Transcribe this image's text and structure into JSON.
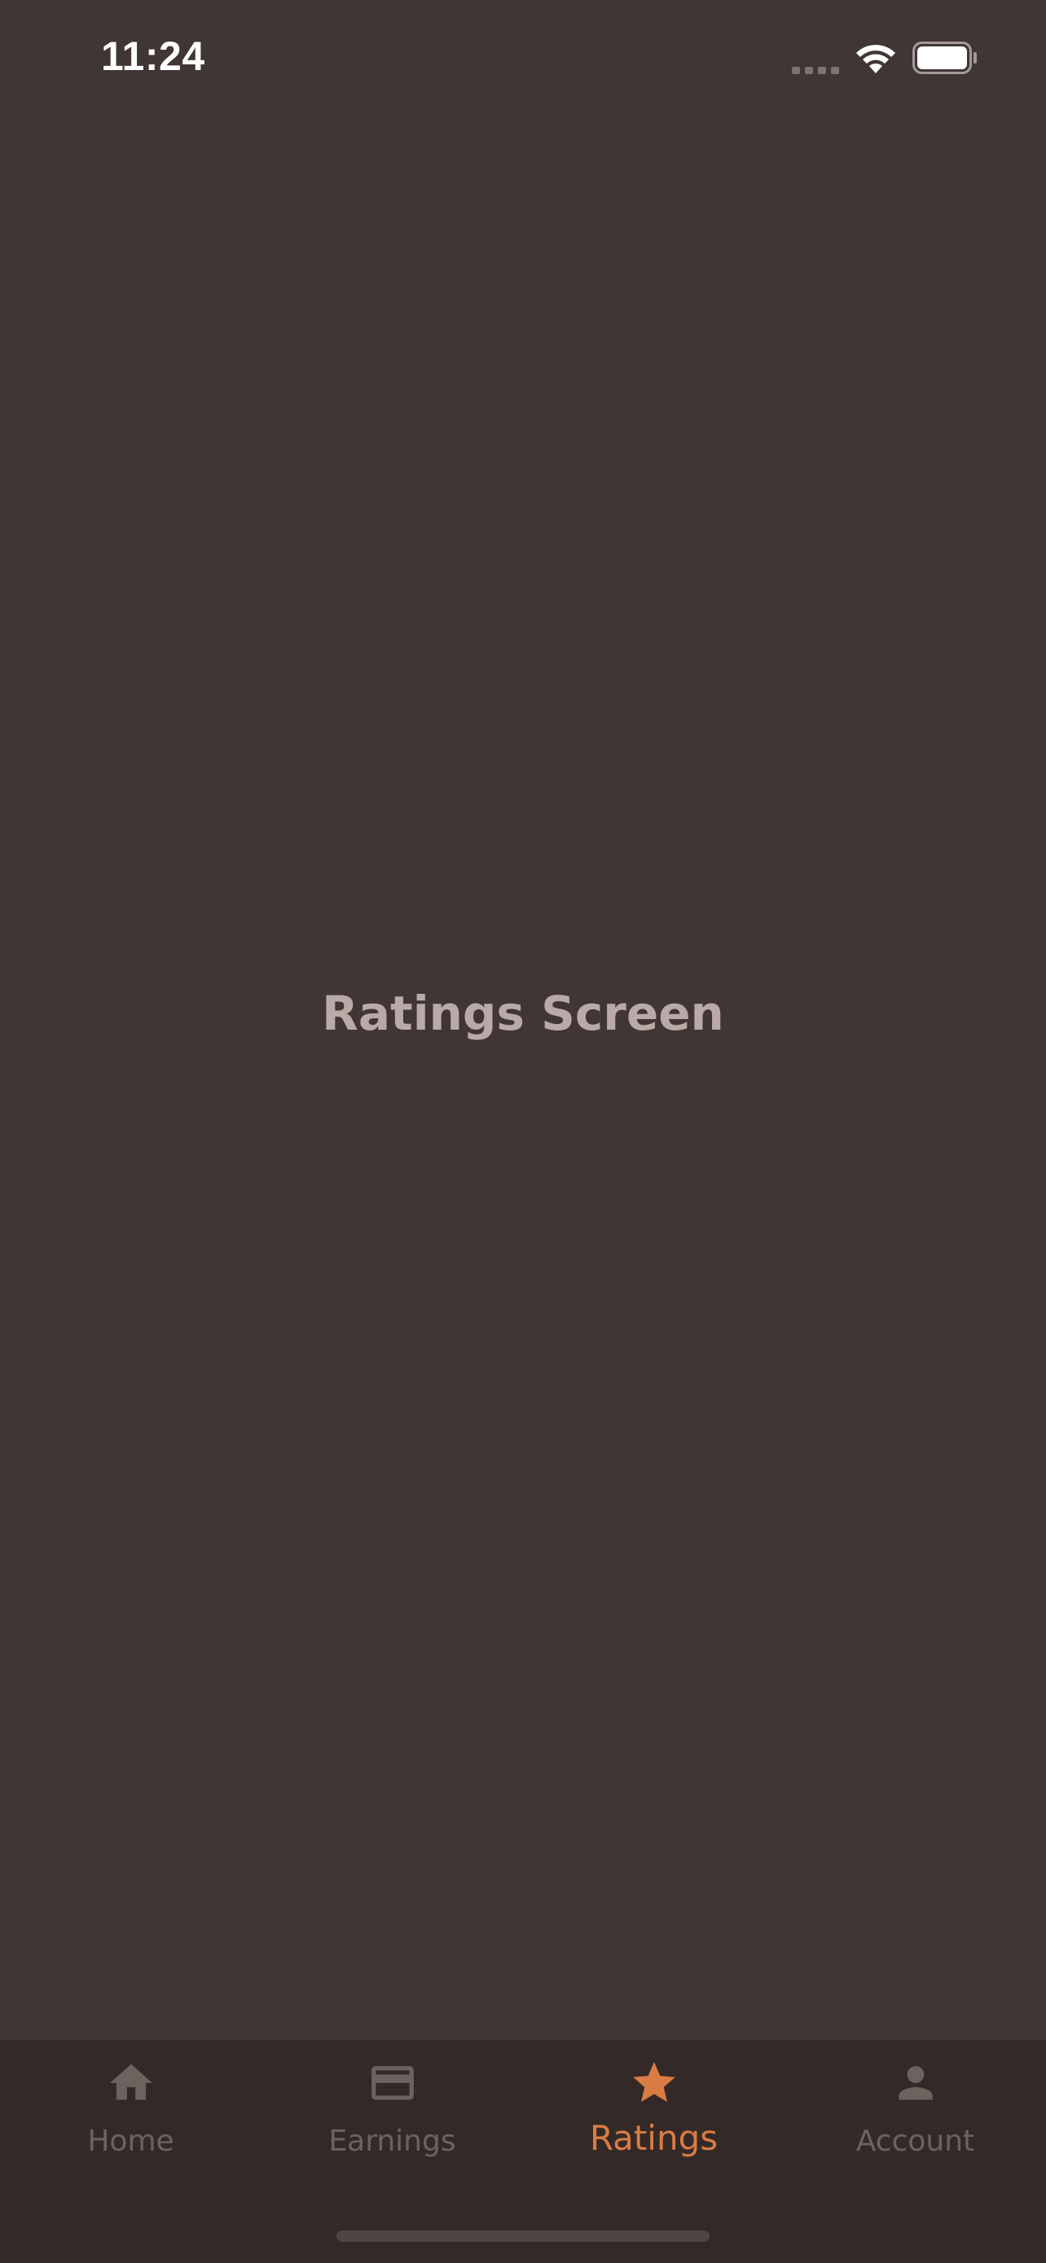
{
  "status_bar": {
    "time": "11:24",
    "signal_icon": "signal-dots-icon",
    "wifi_icon": "wifi-icon",
    "battery_icon": "battery-icon"
  },
  "main": {
    "title": "Ratings Screen"
  },
  "tab_bar": {
    "active_tab": "Ratings",
    "accent_color": "#d97c43",
    "inactive_color": "#6e625f",
    "tabs": [
      {
        "label": "Home",
        "icon": "home-icon"
      },
      {
        "label": "Earnings",
        "icon": "credit-card-icon"
      },
      {
        "label": "Ratings",
        "icon": "star-icon"
      },
      {
        "label": "Account",
        "icon": "person-icon"
      }
    ]
  }
}
